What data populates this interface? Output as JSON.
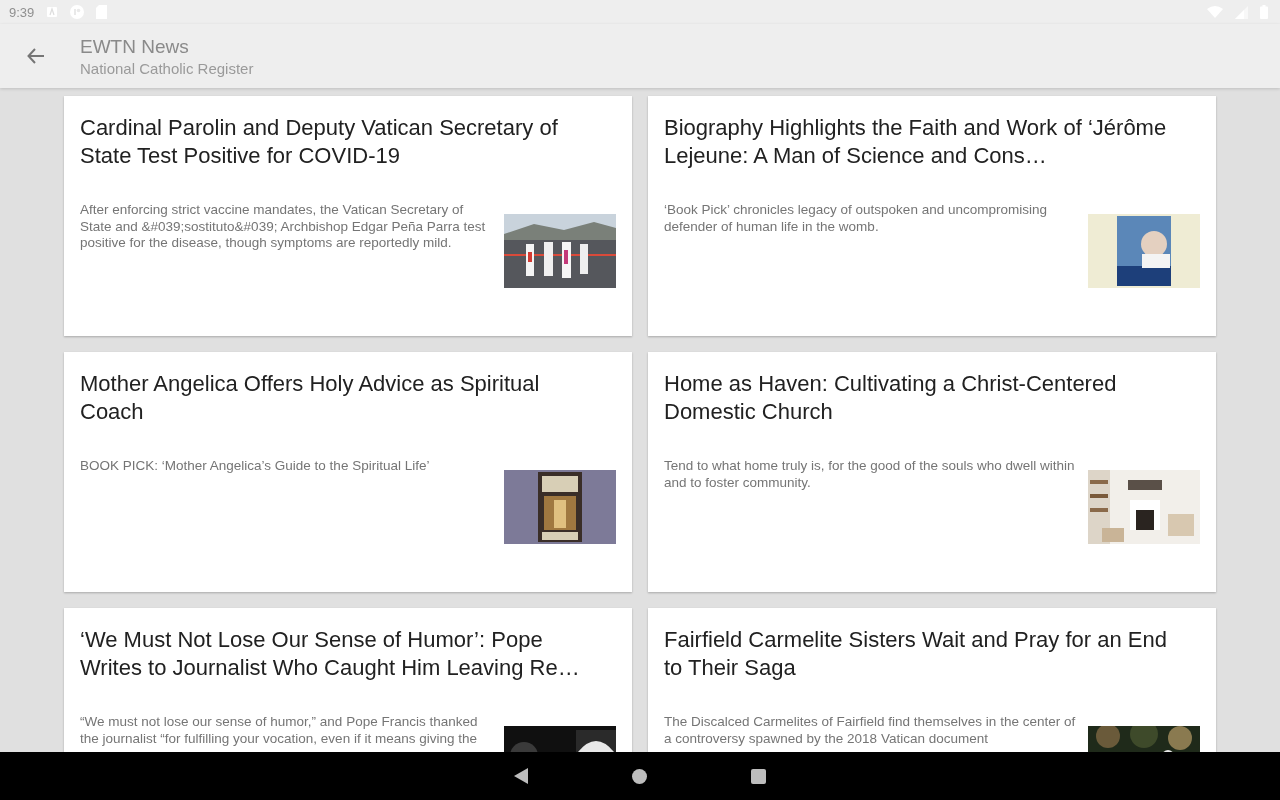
{
  "status_bar": {
    "time": "9:39"
  },
  "app_bar": {
    "title": "EWTN News",
    "subtitle": "National Catholic Register"
  },
  "articles": [
    {
      "title": "Cardinal Parolin and Deputy Vatican Secretary of State Test Positive for COVID-19",
      "summary": " After enforcing strict vaccine mandates, the Vatican Secretary of State and &#039;sostituto&#039; Archbishop Edgar Peña Parra test positive for the disease, though symptoms are reportedly mild."
    },
    {
      "title": "Biography Highlights the Faith and Work of ‘Jérôme Lejeune: A Man of Science and Cons…",
      "summary": " ‘Book Pick’ chronicles legacy of outspoken and uncompromising defender of human life in the womb."
    },
    {
      "title": "Mother Angelica Offers Holy Advice as Spiritual Coach",
      "summary": "BOOK PICK: ‘Mother Angelica’s Guide to the Spiritual Life’"
    },
    {
      "title": "Home as Haven: Cultivating a Christ-Centered Domestic Church",
      "summary": "Tend to what home truly is, for the good of the souls who dwell within and to foster community."
    },
    {
      "title": "‘We Must Not Lose Our Sense of Humor’: Pope Writes to Journalist Who Caught Him Leaving Re…",
      "summary": "“We must not lose our sense of humor,” and Pope Francis thanked the journalist “for fulfilling your vocation, even if it means giving the"
    },
    {
      "title": "Fairfield Carmelite Sisters Wait and Pray for an End to Their Saga",
      "summary": "The Discalced Carmelites of Fairfield find themselves in the center of a controversy spawned by the 2018 Vatican document"
    }
  ]
}
